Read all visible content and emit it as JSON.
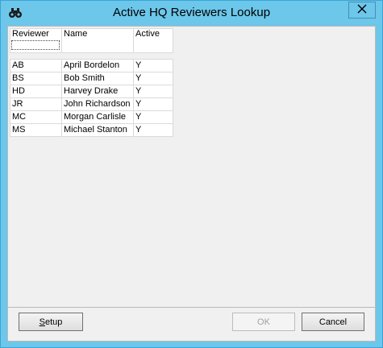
{
  "window": {
    "title": "Active HQ Reviewers Lookup",
    "icon": "binoculars-icon",
    "colors": {
      "titlebar": "#6cc7ea",
      "client": "#f0f0f0"
    }
  },
  "table": {
    "columns": [
      "Reviewer",
      "Name",
      "Active"
    ],
    "filter_value": "",
    "rows": [
      {
        "reviewer": "AB",
        "name": "April Bordelon",
        "active": "Y"
      },
      {
        "reviewer": "BS",
        "name": "Bob Smith",
        "active": "Y"
      },
      {
        "reviewer": "HD",
        "name": "Harvey Drake",
        "active": "Y"
      },
      {
        "reviewer": "JR",
        "name": "John Richardson",
        "active": "Y"
      },
      {
        "reviewer": "MC",
        "name": "Morgan Carlisle",
        "active": "Y"
      },
      {
        "reviewer": "MS",
        "name": "Michael Stanton",
        "active": "Y"
      }
    ]
  },
  "buttons": {
    "setup_accel": "S",
    "setup_rest": "etup",
    "ok": "OK",
    "cancel": "Cancel"
  }
}
